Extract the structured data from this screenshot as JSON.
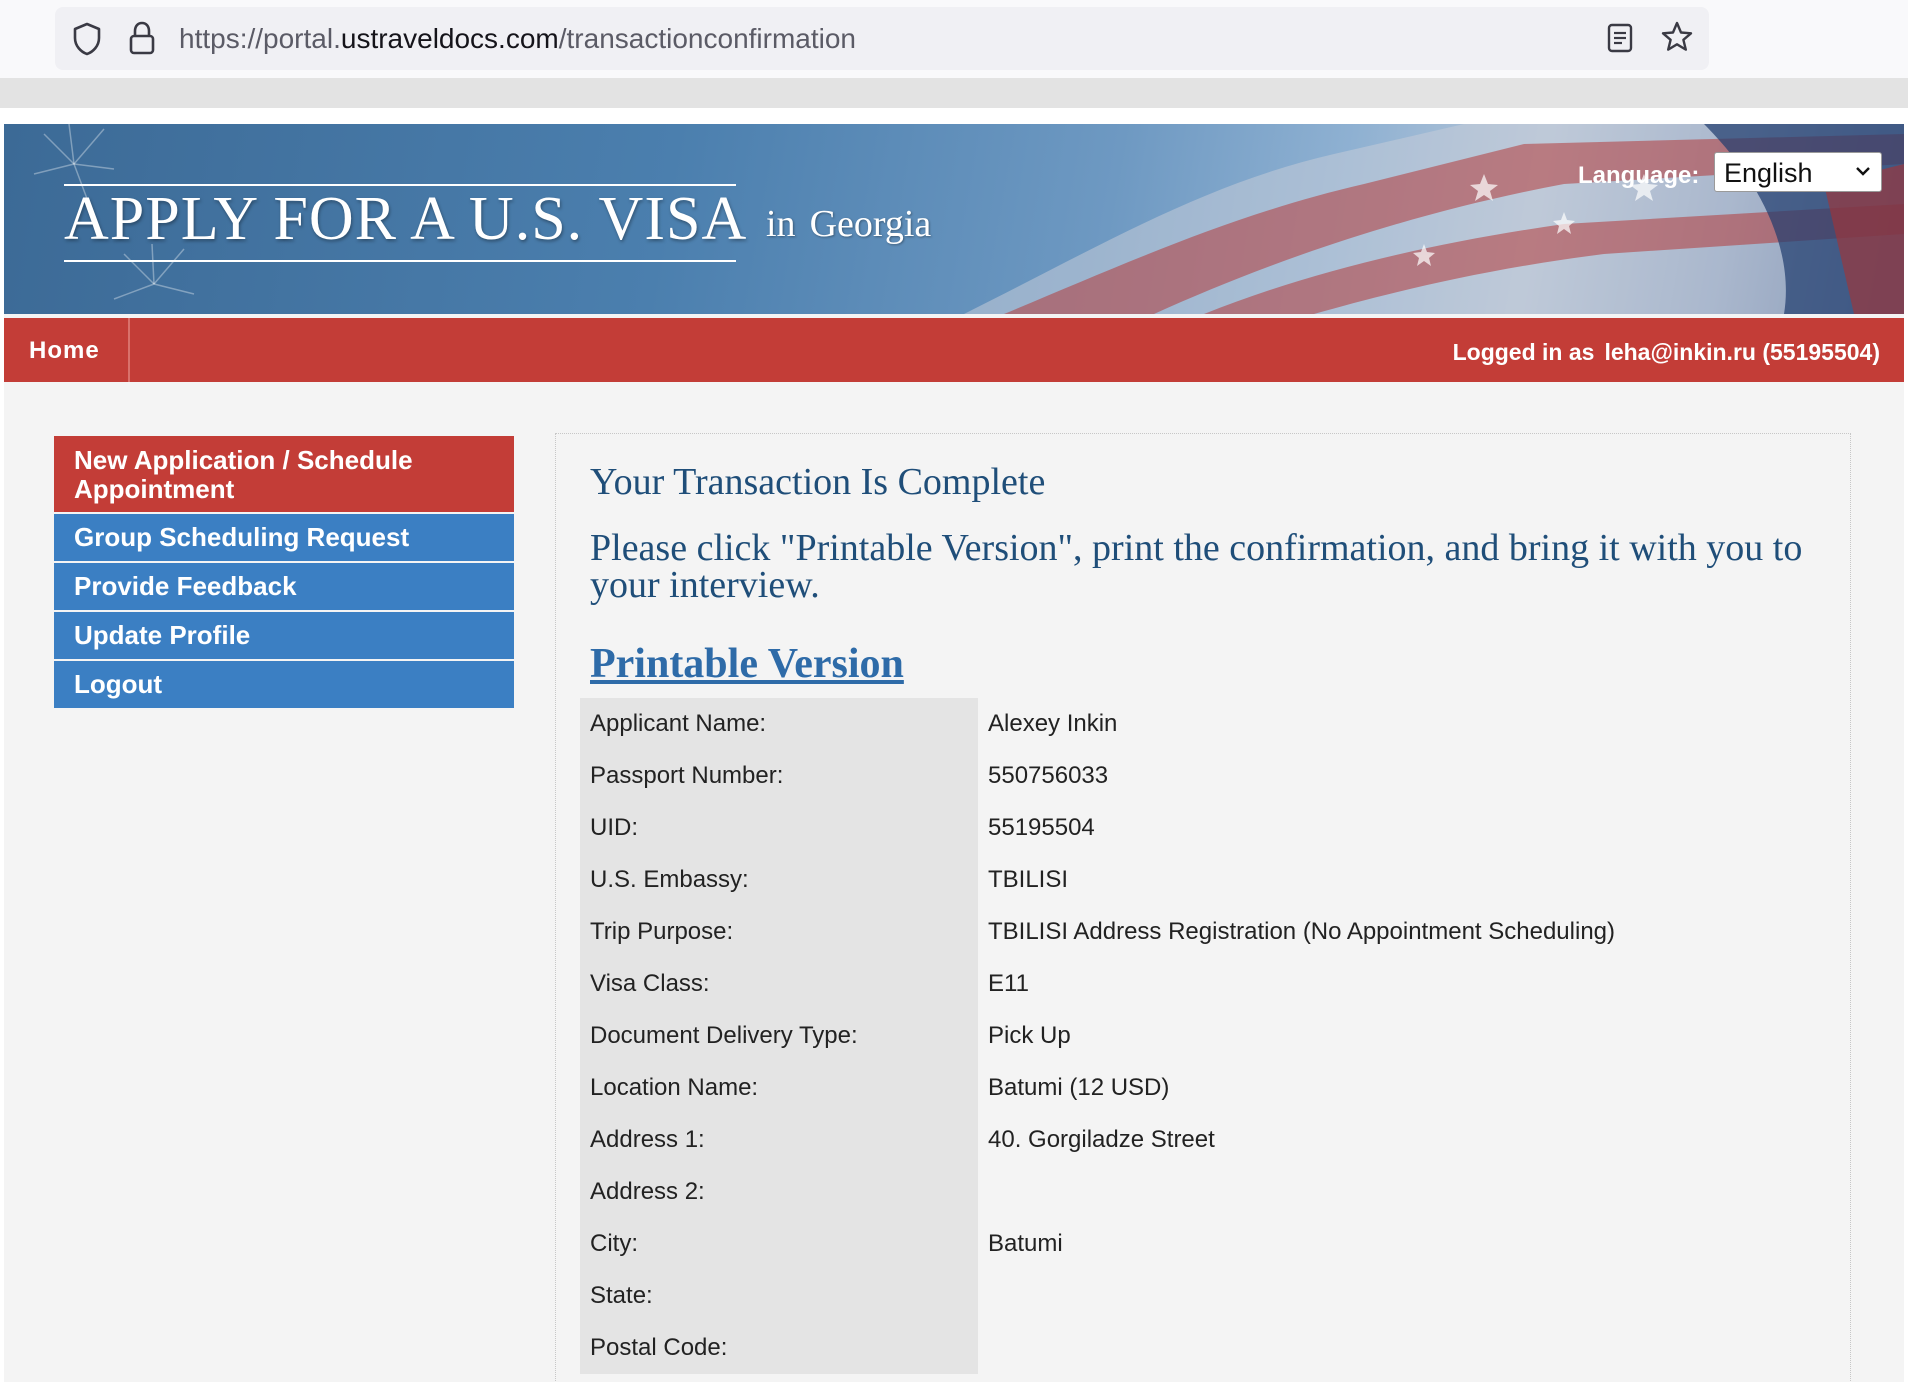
{
  "browser": {
    "url_scheme": "https://portal.",
    "url_host": "ustraveldocs.com",
    "url_path": "/transactionconfirmation"
  },
  "header": {
    "title": "APPLY FOR A U.S. VISA",
    "in_label": "in",
    "country": "Georgia",
    "language_label": "Language:",
    "language_selected": "English"
  },
  "nav": {
    "home": "Home",
    "logged_in_label": "Logged in as",
    "logged_in_user": "leha@inkin.ru (55195504)"
  },
  "sidebar": {
    "items": [
      {
        "label": "New Application / Schedule Appointment",
        "active": true
      },
      {
        "label": "Group Scheduling Request",
        "active": false
      },
      {
        "label": "Provide Feedback",
        "active": false
      },
      {
        "label": "Update Profile",
        "active": false
      },
      {
        "label": "Logout",
        "active": false
      }
    ]
  },
  "main": {
    "heading": "Your Transaction Is Complete",
    "instructions": "Please click \"Printable Version\", print the confirmation, and bring it with you to your interview.",
    "printable_link": "Printable Version",
    "details": [
      {
        "label": "Applicant Name:",
        "value": "Alexey Inkin"
      },
      {
        "label": "Passport Number:",
        "value": "550756033"
      },
      {
        "label": "UID:",
        "value": "55195504"
      },
      {
        "label": "U.S. Embassy:",
        "value": "TBILISI"
      },
      {
        "label": "Trip Purpose:",
        "value": "TBILISI Address Registration (No Appointment Scheduling)"
      },
      {
        "label": "Visa Class:",
        "value": "E11"
      },
      {
        "label": "Document Delivery Type:",
        "value": "Pick Up"
      },
      {
        "label": "Location Name:",
        "value": "Batumi (12 USD)"
      },
      {
        "label": "Address 1:",
        "value": "40. Gorgiladze Street"
      },
      {
        "label": "Address 2:",
        "value": ""
      },
      {
        "label": "City:",
        "value": "Batumi"
      },
      {
        "label": "State:",
        "value": ""
      },
      {
        "label": "Postal Code:",
        "value": ""
      }
    ]
  },
  "colors": {
    "nav_red": "#c33d37",
    "sidebar_blue": "#3b7fc3",
    "heading_navy": "#1f4e79",
    "link_blue": "#2e6ba8"
  }
}
